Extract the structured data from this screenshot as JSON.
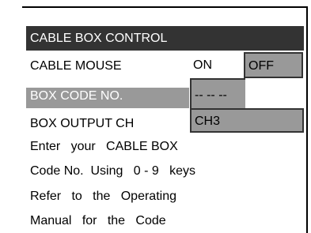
{
  "menu": {
    "title": "CABLE BOX CONTROL",
    "rows": {
      "cable_mouse": {
        "label": "CABLE MOUSE",
        "options": [
          "ON",
          "OFF"
        ],
        "selected": "OFF"
      },
      "box_code": {
        "label": "BOX CODE NO.",
        "value": "-- -- --"
      },
      "box_output": {
        "label": "BOX OUTPUT CH",
        "value": "CH3"
      }
    },
    "help_lines": [
      "Enter   your   CABLE BOX",
      "Code No.  Using   0 - 9   keys",
      "Refer   to   the   Operating",
      "Manual   for   the   Code"
    ]
  },
  "colors": {
    "title_background": "#333333",
    "highlight": "#999999",
    "text": "#000000",
    "inverse_text": "#ffffff"
  }
}
